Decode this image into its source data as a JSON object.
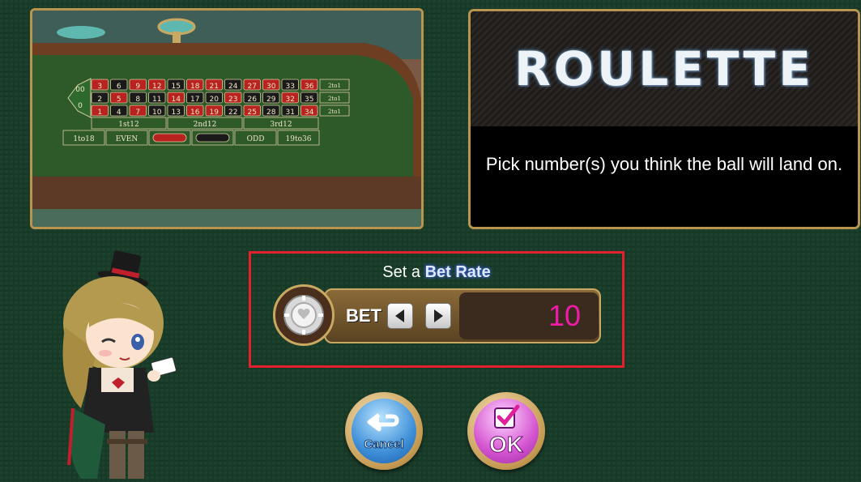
{
  "table": {
    "numbers_top": [
      "3",
      "6",
      "9",
      "12",
      "15",
      "18",
      "21",
      "24",
      "27",
      "30",
      "33",
      "36"
    ],
    "numbers_mid": [
      "2",
      "5",
      "8",
      "11",
      "14",
      "17",
      "20",
      "23",
      "26",
      "29",
      "32",
      "35"
    ],
    "numbers_bot": [
      "1",
      "4",
      "7",
      "10",
      "13",
      "16",
      "19",
      "22",
      "25",
      "28",
      "31",
      "34"
    ],
    "zeros": [
      "00",
      "0"
    ],
    "dozens": [
      "1st12",
      "2nd12",
      "3rd12"
    ],
    "outside": [
      "1to18",
      "EVEN",
      "ODD",
      "19to36"
    ],
    "columns": [
      "2to1",
      "2to1",
      "2to1"
    ]
  },
  "title": {
    "name": "ROULETTE",
    "instruction": "Pick number(s) you think the ball will land on."
  },
  "bet": {
    "prompt_prefix": "Set a ",
    "prompt_emphasis": "Bet Rate",
    "label": "BET",
    "value": "10",
    "value_color": "#f01ca8",
    "prev_icon": "left-arrow-icon",
    "next_icon": "right-arrow-icon"
  },
  "buttons": {
    "cancel_label": "Cancel",
    "ok_label": "OK",
    "cancel_icon": "return-arrow-icon",
    "ok_icon": "checkbox-check-icon"
  },
  "colors": {
    "felt": "#173a27",
    "highlight_border": "#e3202b",
    "frame_gold": "#b8954f"
  }
}
